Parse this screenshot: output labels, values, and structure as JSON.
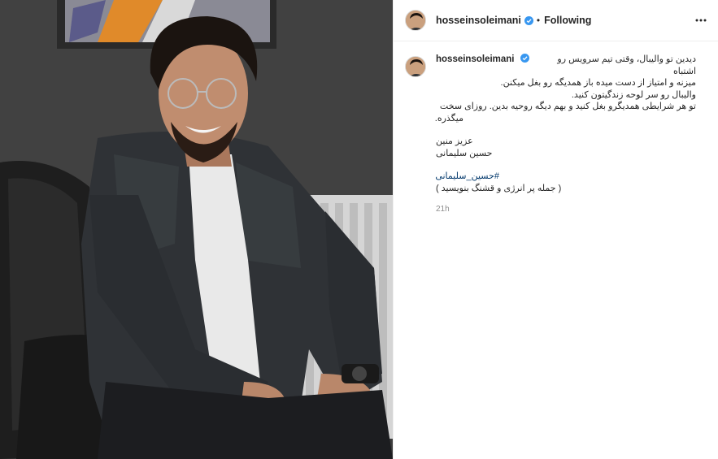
{
  "post": {
    "username": "hosseinsoleimani",
    "separator": "•",
    "follow_status": "Following",
    "caption_lines": [
      "دیدین تو والیبال، وقتی تیم سرویس رو اشتباه",
      "میزنه و امتیاز از دست میده باز همدیگه رو بغل میکنن.",
      "والیبال رو سر لوحه زندگیتون کنید.",
      "تو هر شرایطی همدیگرو بغل کنید و بهم دیگه روحیه بدین. روزای سخت",
      "میگذره."
    ],
    "signoff_lines": [
      "عزیز منین",
      "حسین سلیمانی"
    ],
    "hashtag": "#حسین_سلیمانی",
    "call_to_action": "( جمله پر انرژی و قشنگ بنویسید )",
    "timestamp": "21h"
  },
  "icons": {
    "verified": "verified-badge-icon",
    "more": "more-options-icon"
  },
  "colors": {
    "verified": "#3897f0",
    "hashtag": "#00376b",
    "muted": "#8e8e8e"
  }
}
